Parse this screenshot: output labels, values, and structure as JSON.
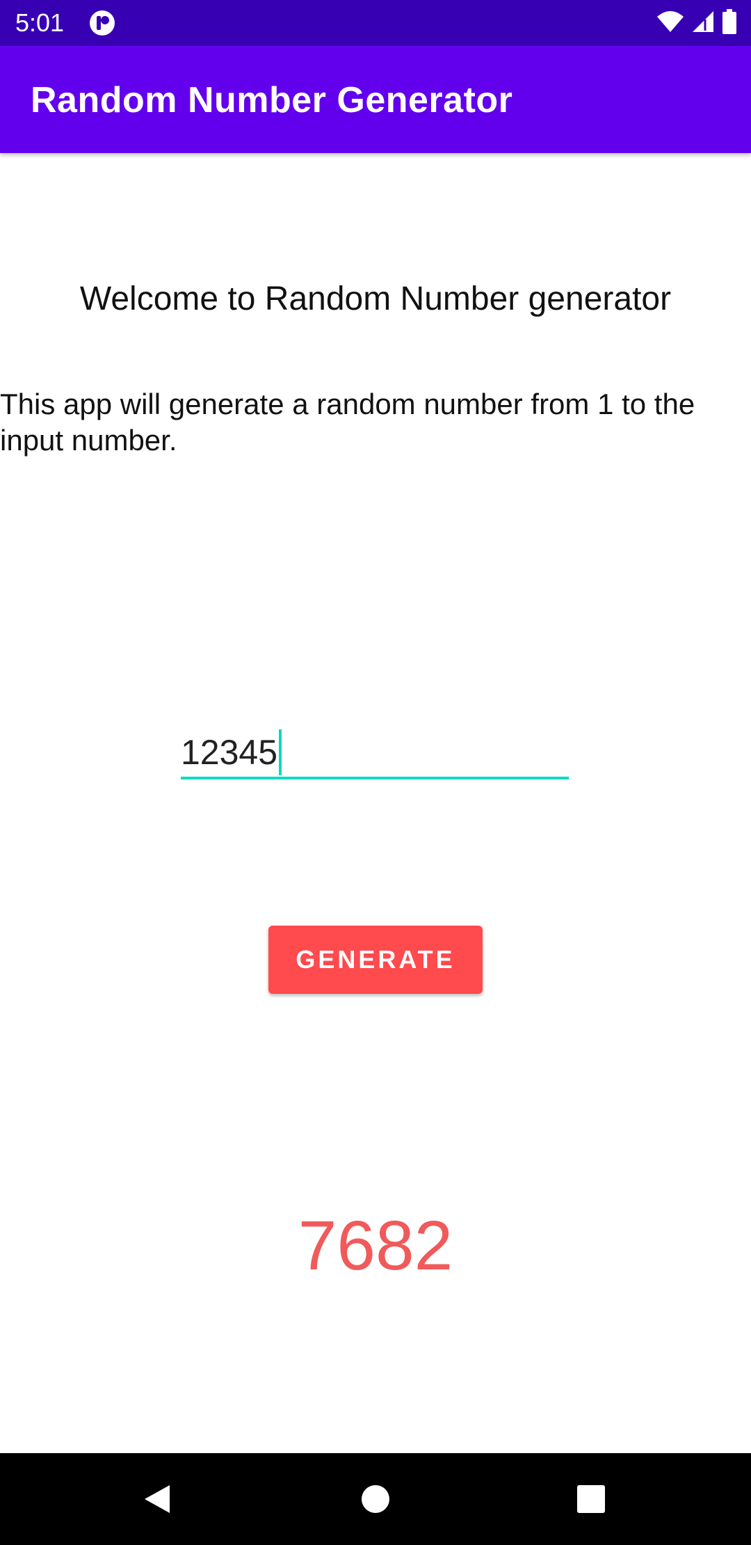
{
  "status_bar": {
    "time": "5:01",
    "app_icon": "notification-app-icon",
    "icons": [
      "wifi-icon",
      "signal-icon",
      "battery-icon"
    ],
    "background": "#3700B3"
  },
  "app_bar": {
    "title": "Random Number Generator",
    "background": "#6200EE"
  },
  "main": {
    "welcome_text": "Welcome to Random Number generator",
    "description": "This app will generate a random number from 1 to the input number.",
    "input": {
      "value": "12345",
      "underline_color": "#03DAC5"
    },
    "generate_button": {
      "label": "GENERATE",
      "background": "#FF4A4E"
    },
    "result": {
      "value": "7682",
      "color": "#F05A5A"
    }
  },
  "nav_bar": {
    "buttons": [
      "back-icon",
      "home-icon",
      "recents-icon"
    ]
  }
}
